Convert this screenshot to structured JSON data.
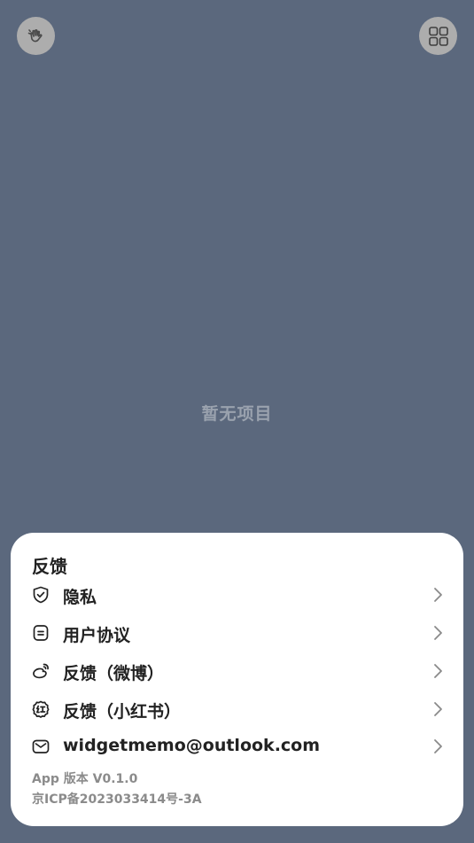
{
  "top_bar": {
    "left_icon": "hand-wave-icon",
    "right_icon": "grid-icon"
  },
  "empty_state": {
    "text": "暂无项目"
  },
  "sheet": {
    "title": "反馈",
    "items": [
      {
        "icon": "shield-check-icon",
        "label": "隐私"
      },
      {
        "icon": "document-icon",
        "label": "用户协议"
      },
      {
        "icon": "weibo-icon",
        "label": "反馈（微博）"
      },
      {
        "icon": "xiaohongshu-icon",
        "label": "反馈（小红书）"
      },
      {
        "icon": "mail-icon",
        "label": "widgetmemo@outlook.com"
      }
    ],
    "version": "App 版本 V0.1.0",
    "icp": "京ICP备2023033414号-3A"
  },
  "colors": {
    "background": "#5b687d",
    "button": "#adadad",
    "sheet": "#ffffff",
    "text": "#222222",
    "muted": "#8b8b8b"
  }
}
